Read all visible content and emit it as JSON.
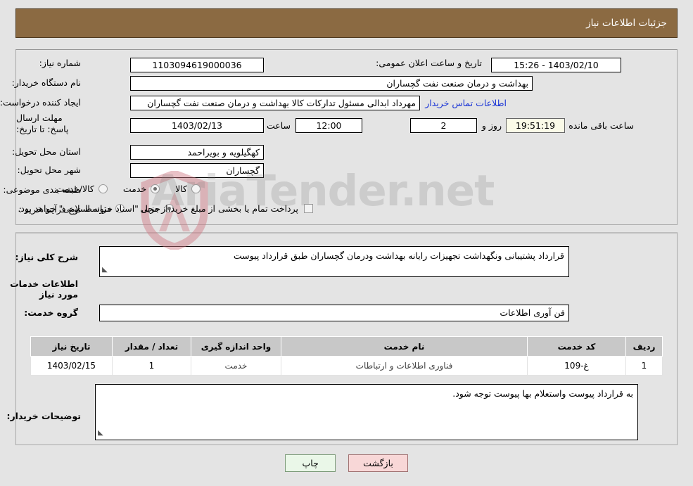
{
  "header": {
    "title": "جزئیات اطلاعات نیاز"
  },
  "form": {
    "need_number": {
      "label": "شماره نیاز:",
      "value": "1103094619000036"
    },
    "buyer_org": {
      "label": "نام دستگاه خریدار:",
      "value": "بهداشت و درمان صنعت نفت گچساران"
    },
    "requester": {
      "label": "ایجاد کننده درخواست:",
      "value": "مهرداد ابدالی مسئول تدارکات کالا  بهداشت و درمان صنعت نفت گچساران"
    },
    "contact_link": "اطلاعات تماس خریدار",
    "announce_datetime": {
      "label": "تاریخ و ساعت اعلان عمومی:",
      "value": "1403/02/10 - 15:26"
    },
    "deadline": {
      "label": "مهلت ارسال پاسخ: تا تاریخ:",
      "date": "1403/02/13",
      "time_label": "ساعت",
      "time": "12:00",
      "days": "2",
      "days_label": "روز و",
      "countdown": "19:51:19",
      "countdown_label": "ساعت باقی مانده"
    },
    "delivery_province": {
      "label": "استان محل تحویل:",
      "value": "کهگیلویه و بویراحمد"
    },
    "delivery_city": {
      "label": "شهر محل تحویل:",
      "value": "گچساران"
    },
    "category": {
      "label": "طبقه بندی موضوعی:",
      "options": [
        {
          "label": "کالا",
          "selected": false
        },
        {
          "label": "خدمت",
          "selected": true
        },
        {
          "label": "کالا/خدمت",
          "selected": false
        }
      ]
    },
    "purchase_type": {
      "label": "نوع فرآیند خرید :",
      "options": [
        {
          "label": "جزیی",
          "selected": true
        },
        {
          "label": "متوسط",
          "selected": false
        }
      ],
      "treasury_checkbox": {
        "label": "پرداخت تمام یا بخشی از مبلغ خرید،از محل \"اسناد خزانه اسلامی\" خواهد بود.",
        "checked": false
      }
    }
  },
  "description": {
    "label": "شرح کلی نیاز:",
    "value": "قرارداد پشتیبانی ونگهداشت تجهیزات رایانه بهداشت ودرمان گچساران طبق قرارداد پیوست"
  },
  "services_section": {
    "heading": "اطلاعات خدمات مورد نیاز",
    "group_label": "گروه خدمت:",
    "group_value": "فن آوری اطلاعات"
  },
  "table": {
    "columns": [
      "ردیف",
      "کد خدمت",
      "نام خدمت",
      "واحد اندازه گیری",
      "تعداد / مقدار",
      "تاریخ نیاز"
    ],
    "rows": [
      {
        "row_no": "1",
        "service_code": "غ-109",
        "service_name": "فناوری اطلاعات و ارتباطات",
        "unit": "خدمت",
        "quantity": "1",
        "need_date": "1403/02/15"
      }
    ]
  },
  "buyer_notes": {
    "label": "توضیحات خریدار:",
    "value": "به قرارداد پیوست واستعلام بها پیوست توجه شود."
  },
  "buttons": {
    "print": "چاپ",
    "back": "بازگشت"
  },
  "watermark": {
    "text": "AriaTender.net"
  },
  "colors": {
    "header_bg": "#8b6a42",
    "page_bg": "#e4e4e4",
    "link": "#1b35d6",
    "timer_bg": "#fbfbe8",
    "print_btn_bg": "#eaf7e8",
    "back_btn_bg": "#f8d7d7"
  }
}
